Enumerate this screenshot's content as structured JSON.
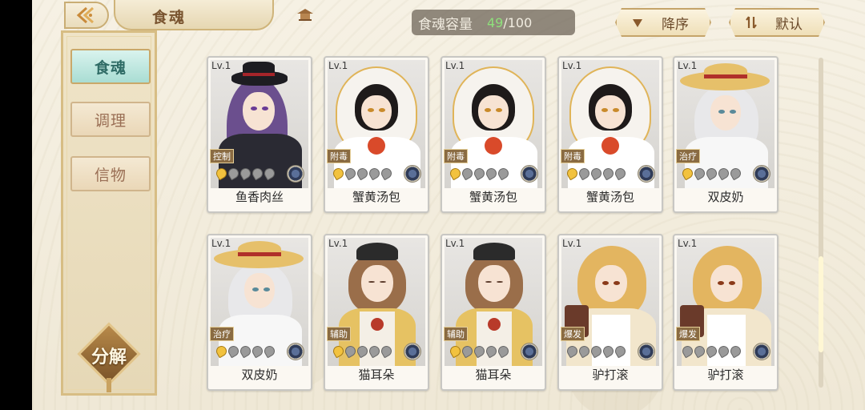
{
  "header": {
    "title": "食魂",
    "capacity_label": "食魂容量",
    "capacity_current": "49",
    "capacity_max": "/100",
    "sort_order_label": "降序",
    "sort_mode_label": "默认"
  },
  "sidebar": {
    "tabs": [
      {
        "label": "食魂",
        "active": true
      },
      {
        "label": "调理",
        "active": false
      },
      {
        "label": "信物",
        "active": false
      }
    ],
    "split_label": "分解"
  },
  "cards": [
    {
      "level": "Lv.1",
      "name": "鱼香肉丝",
      "role": "控制",
      "stars": 1
    },
    {
      "level": "Lv.1",
      "name": "蟹黄汤包",
      "role": "附毒",
      "stars": 1
    },
    {
      "level": "Lv.1",
      "name": "蟹黄汤包",
      "role": "附毒",
      "stars": 1
    },
    {
      "level": "Lv.1",
      "name": "蟹黄汤包",
      "role": "附毒",
      "stars": 1
    },
    {
      "level": "Lv.1",
      "name": "双皮奶",
      "role": "治疗",
      "stars": 1
    },
    {
      "level": "Lv.1",
      "name": "双皮奶",
      "role": "治疗",
      "stars": 1
    },
    {
      "level": "Lv.1",
      "name": "猫耳朵",
      "role": "辅助",
      "stars": 1
    },
    {
      "level": "Lv.1",
      "name": "猫耳朵",
      "role": "辅助",
      "stars": 1
    },
    {
      "level": "Lv.1",
      "name": "驴打滚",
      "role": "爆发",
      "stars": 0
    },
    {
      "level": "Lv.1",
      "name": "驴打滚",
      "role": "爆发",
      "stars": 0
    }
  ],
  "colors": {
    "accent_teal": "#a9ddd3",
    "gold_border": "#c9a86a",
    "capacity_current": "#8ee07b"
  }
}
